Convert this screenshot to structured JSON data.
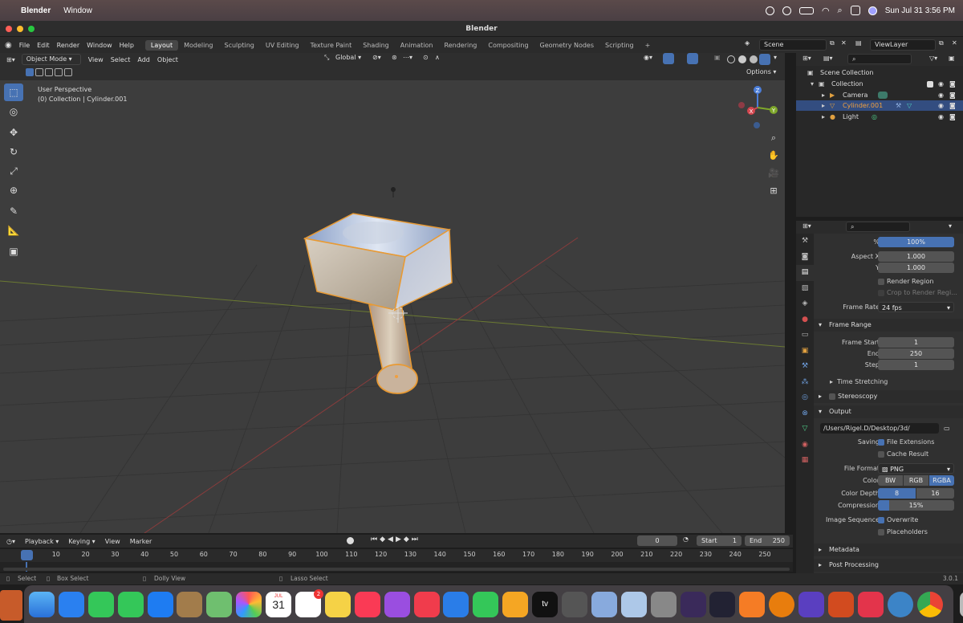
{
  "mac_menubar": {
    "app": "Blender",
    "menu": [
      "Window"
    ],
    "datetime": "Sun Jul 31  3:56 PM"
  },
  "window_title": "Blender",
  "top_menu": [
    "File",
    "Edit",
    "Render",
    "Window",
    "Help"
  ],
  "workspaces": [
    "Layout",
    "Modeling",
    "Sculpting",
    "UV Editing",
    "Texture Paint",
    "Shading",
    "Animation",
    "Rendering",
    "Compositing",
    "Geometry Nodes",
    "Scripting"
  ],
  "active_workspace": "Layout",
  "scene_name": "Scene",
  "view_layer": "ViewLayer",
  "viewport": {
    "mode": "Object Mode",
    "menus": [
      "View",
      "Select",
      "Add",
      "Object"
    ],
    "orientation": "Global",
    "options_label": "Options",
    "perspective": "User Perspective",
    "collection_info": "(0) Collection | Cylinder.001",
    "gizmo_axes": {
      "x": "X",
      "y": "Y",
      "z": "Z"
    }
  },
  "outliner": {
    "rows": [
      {
        "label": "Scene Collection",
        "indent": 0
      },
      {
        "label": "Collection",
        "indent": 1
      },
      {
        "label": "Camera",
        "indent": 2
      },
      {
        "label": "Cylinder.001",
        "indent": 2,
        "selected": true
      },
      {
        "label": "Light",
        "indent": 2
      }
    ]
  },
  "properties": {
    "percent_label": "%",
    "percent_value": "100%",
    "aspect_x_label": "Aspect X",
    "aspect_x": "1.000",
    "aspect_y_label": "Y",
    "aspect_y": "1.000",
    "render_region": "Render Region",
    "crop_region": "Crop to Render Regi...",
    "frame_rate_label": "Frame Rate",
    "frame_rate": "24 fps",
    "frame_range_title": "Frame Range",
    "frame_start_label": "Frame Start",
    "frame_start": "1",
    "end_label": "End",
    "end": "250",
    "step_label": "Step",
    "step": "1",
    "time_stretching": "Time Stretching",
    "stereoscopy": "Stereoscopy",
    "output_title": "Output",
    "output_path": "/Users/Rigel.D/Desktop/3d/",
    "saving_label": "Saving",
    "file_extensions": "File Extensions",
    "cache_result": "Cache Result",
    "file_format_label": "File Format",
    "file_format": "PNG",
    "color_label": "Color",
    "color_options": [
      "BW",
      "RGB",
      "RGBA"
    ],
    "color_selected": "RGBA",
    "color_depth_label": "Color Depth",
    "color_depth_options": [
      "8",
      "16"
    ],
    "color_depth_selected": "8",
    "compression_label": "Compression",
    "compression": "15%",
    "compression_fraction": 0.15,
    "image_sequence_label": "Image Sequence",
    "overwrite": "Overwrite",
    "placeholders": "Placeholders",
    "metadata": "Metadata",
    "post_processing": "Post Processing"
  },
  "timeline": {
    "menus": [
      "Playback",
      "Keying",
      "View",
      "Marker"
    ],
    "current_frame": "0",
    "start_label": "Start",
    "start": "1",
    "end_label": "End",
    "end": "250",
    "ticks": [
      "0",
      "10",
      "20",
      "30",
      "40",
      "50",
      "60",
      "70",
      "80",
      "90",
      "100",
      "110",
      "120",
      "130",
      "140",
      "150",
      "160",
      "170",
      "180",
      "190",
      "200",
      "210",
      "220",
      "230",
      "240",
      "250"
    ]
  },
  "statusbar": {
    "select": "Select",
    "box_select": "Box Select",
    "dolly_view": "Dolly View",
    "lasso_select": "Lasso Select",
    "version": "3.0.1"
  },
  "dock": {
    "calendar_month": "JUL",
    "calendar_day": "31",
    "reminders_badge": "2",
    "appletv_label": "tv"
  }
}
